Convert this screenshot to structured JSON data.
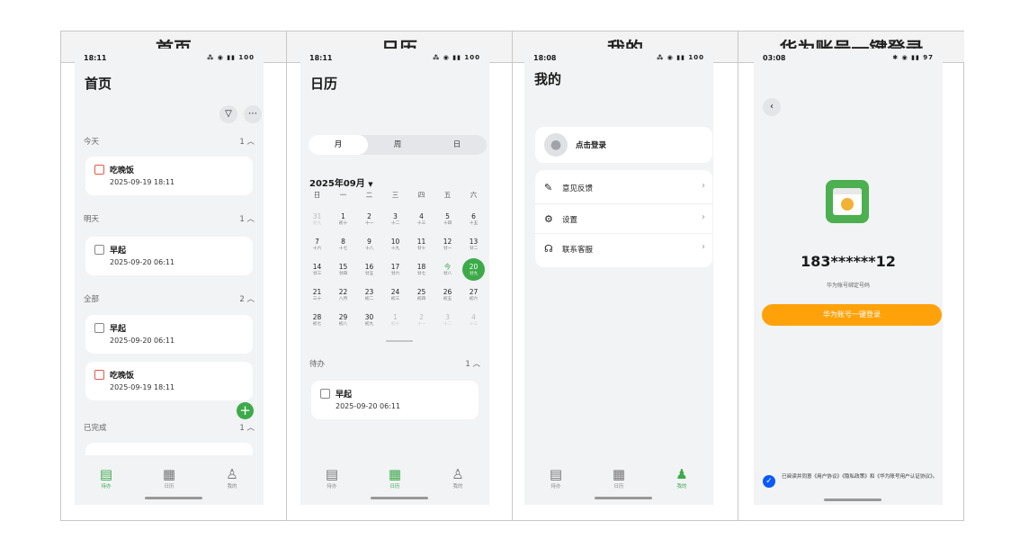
{
  "headers": [
    "首页",
    "日历",
    "我的",
    "华为账号一键登录"
  ],
  "home": {
    "time": "18:11",
    "status_icons": "⁂ ◉ ▮▮ 100",
    "title": "首页",
    "filter_icon": "funnel-icon",
    "more_icon": "more-icon",
    "sections": [
      {
        "label": "今天",
        "count": "1"
      },
      {
        "label": "明天",
        "count": "1"
      },
      {
        "label": "全部",
        "count": "2"
      },
      {
        "label": "已完成",
        "count": "1"
      }
    ],
    "cards": [
      {
        "title": "吃晚饭",
        "date": "2025-09-19 18:11"
      },
      {
        "title": "早起",
        "date": "2025-09-20 06:11"
      },
      {
        "title": "早起",
        "date": "2025-09-20 06:11"
      },
      {
        "title": "吃晚饭",
        "date": "2025-09-19 18:11"
      }
    ],
    "fab_icon": "plus-icon"
  },
  "calendar": {
    "time": "18:11",
    "status_icons": "⁂ ◉ ▮▮ 100",
    "title": "日历",
    "segments": [
      "月",
      "周",
      "日"
    ],
    "month": "2025年09月",
    "weekdays": [
      "日",
      "一",
      "二",
      "三",
      "四",
      "五",
      "六"
    ],
    "weeks": [
      [
        [
          "31",
          "初九"
        ],
        [
          "1",
          "初十"
        ],
        [
          "2",
          "十一"
        ],
        [
          "3",
          "十二"
        ],
        [
          "4",
          "十三"
        ],
        [
          "5",
          "十四"
        ],
        [
          "6",
          "十五"
        ]
      ],
      [
        [
          "7",
          "十六"
        ],
        [
          "8",
          "十七"
        ],
        [
          "9",
          "十八"
        ],
        [
          "10",
          "十九"
        ],
        [
          "11",
          "廿十"
        ],
        [
          "12",
          "廿一"
        ],
        [
          "13",
          "廿二"
        ]
      ],
      [
        [
          "14",
          "廿三"
        ],
        [
          "15",
          "廿四"
        ],
        [
          "16",
          "廿五"
        ],
        [
          "17",
          "廿六"
        ],
        [
          "18",
          "廿七"
        ],
        [
          "今",
          "廿八"
        ],
        [
          "20",
          "廿九"
        ]
      ],
      [
        [
          "21",
          "三十"
        ],
        [
          "22",
          "八月"
        ],
        [
          "23",
          "初二"
        ],
        [
          "24",
          "初三"
        ],
        [
          "25",
          "初四"
        ],
        [
          "26",
          "初五"
        ],
        [
          "27",
          "初六"
        ]
      ],
      [
        [
          "28",
          "初七"
        ],
        [
          "29",
          "初八"
        ],
        [
          "30",
          "初九"
        ],
        [
          "1",
          "初十"
        ],
        [
          "2",
          "十一"
        ],
        [
          "3",
          "十二"
        ],
        [
          "4",
          "十三"
        ]
      ]
    ],
    "todo_label": "待办",
    "todo_count": "1",
    "todo": {
      "title": "早起",
      "date": "2025-09-20 06:11"
    }
  },
  "mine": {
    "time": "18:08",
    "status_icons": "⁂ ◉ ▮▮ 100",
    "title": "我的",
    "login_text": "点击登录",
    "menu": [
      {
        "label": "意见反馈",
        "icon": "feedback-icon"
      },
      {
        "label": "设置",
        "icon": "gear-icon"
      },
      {
        "label": "联系客服",
        "icon": "headset-icon"
      }
    ]
  },
  "huawei": {
    "time": "03:08",
    "status_icons": "✱ ◉ ▮▮ 97",
    "phone": "183******12",
    "sub": "华为账号绑定号码",
    "button": "华为账号一键登录",
    "agree": "已阅读并同意《用户协议》《隐私政策》和《华为账号用户认证协议》。"
  },
  "tabs": [
    "待办",
    "日历",
    "我的"
  ],
  "colors": {
    "accent": "#3daa4a",
    "orange": "#ffa20a",
    "blue": "#0a59f7",
    "red": "#e2574c"
  }
}
